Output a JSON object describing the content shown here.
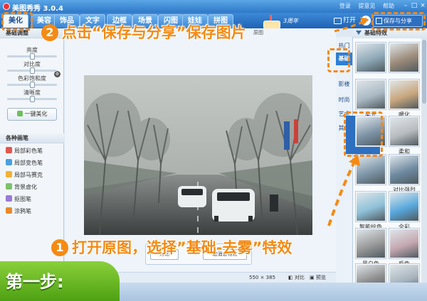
{
  "app": {
    "title": "美图秀秀 3.0.4",
    "anniversary": "3周年"
  },
  "top_links": [
    "登录",
    "提意见",
    "帮助"
  ],
  "tabs": [
    {
      "label": "美化",
      "active": true
    },
    {
      "label": "美容"
    },
    {
      "label": "饰品"
    },
    {
      "label": "文字"
    },
    {
      "label": "边框"
    },
    {
      "label": "场景"
    },
    {
      "label": "闪图"
    },
    {
      "label": "娃娃"
    },
    {
      "label": "拼图"
    }
  ],
  "toolbar": {
    "open_label": "打开",
    "plus_label": "+",
    "save_label": "保存与分享"
  },
  "left": {
    "adjust_title": "基础调整",
    "adjustments": [
      {
        "label": "亮度",
        "level": 0.5
      },
      {
        "label": "对比度",
        "level": 0.5
      },
      {
        "label": "色彩饱和度",
        "level": 0.5
      },
      {
        "label": "清晰度",
        "level": 0.5
      }
    ],
    "onekey_label": "一键美化",
    "pens_title": "各种画笔",
    "pens": [
      {
        "label": "局部彩色笔",
        "color": "#e2574c"
      },
      {
        "label": "局部变色笔",
        "color": "#4aa0e0"
      },
      {
        "label": "局部马赛克",
        "color": "#f2b134"
      },
      {
        "label": "背景虚化",
        "color": "#7cc36a"
      },
      {
        "label": "抠图笔",
        "color": "#9a7ad6"
      },
      {
        "label": "涂鸦笔",
        "color": "#e88a2c"
      }
    ]
  },
  "canvas": {
    "scale_label": "原图",
    "float_left": "对比",
    "float_right": "取消该特效",
    "dimensions": "550 × 385",
    "compare_label": "对比",
    "preview_label": "预览"
  },
  "categories": [
    {
      "label": "热门"
    },
    {
      "label": "基础",
      "active": true
    },
    {
      "label": "影楼"
    },
    {
      "label": "时尚"
    },
    {
      "label": "艺术"
    },
    {
      "label": "其他"
    }
  ],
  "effects": {
    "header": "基础特效",
    "items": [
      {
        "label": "",
        "tone": "#8fa9b8"
      },
      {
        "label": "",
        "tone": "#9c8b7a"
      },
      {
        "label": "柔光",
        "tone": "#aab9c4"
      },
      {
        "label": "暖化",
        "tone": "#c9a77e"
      },
      {
        "label": "",
        "tone": "#7d93a6"
      },
      {
        "label": "柔和",
        "tone": "#b8bcc0"
      },
      {
        "label": "去雾",
        "tone": "#7f98aa",
        "selected": true
      },
      {
        "label": "对比强烈",
        "tone": "#6e8aa0"
      },
      {
        "label": "智能绘色",
        "tone": "#8fc1d8"
      },
      {
        "label": "全彩",
        "tone": "#57a8dc"
      },
      {
        "label": "黑白色",
        "tone": "#9a9a9a"
      },
      {
        "label": "反色",
        "tone": "#c4a8b0"
      },
      {
        "label": "",
        "tone": "#8a8a8a"
      },
      {
        "label": "",
        "tone": "#a6b2bc"
      }
    ]
  },
  "annotations": {
    "step_badge": "第一步:",
    "step2_number": "2",
    "step2_text": "点击“保存与分享”保存图片",
    "step1_number": "1",
    "step1_text": "打开原图，选择”基础-去雾”特效",
    "accent": "#f58a14"
  }
}
